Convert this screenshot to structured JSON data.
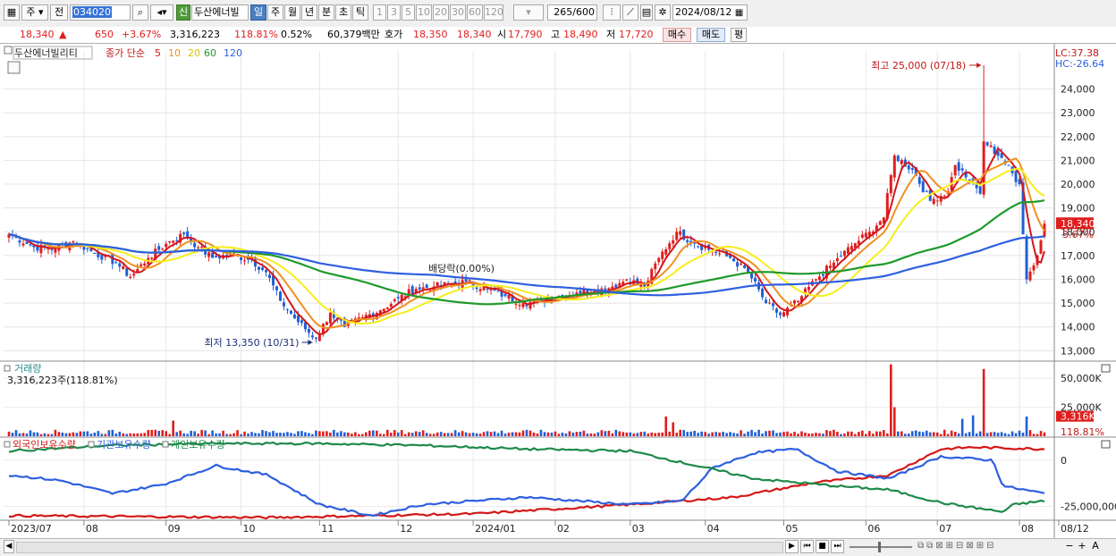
{
  "toolbar": {
    "type_label": "주",
    "prev_label": "전",
    "code": "034020",
    "name_badge": "신",
    "name": "두산에너빌",
    "periods": [
      "일",
      "주",
      "월",
      "년",
      "분",
      "초",
      "틱"
    ],
    "active_period": "일",
    "intervals": [
      "1",
      "3",
      "5",
      "10",
      "20",
      "30",
      "60",
      "120"
    ],
    "bars_shown": "265",
    "bars_total": "/600",
    "date": "2024/08/12"
  },
  "quote": {
    "price": "18,340",
    "arrow": "▲",
    "change": "650",
    "change_pct": "+3.67%",
    "volume": "3,316,223",
    "volume_ratio": "118.81%",
    "turnover": "0.52%",
    "amount": "60,379백만",
    "bid_label": "호가",
    "bid1": "18,350",
    "bid2": "18,340",
    "open_label": "시",
    "open": "17,790",
    "high_label": "고",
    "high": "18,490",
    "low_label": "저",
    "low": "17,720",
    "buy_label": "매수",
    "sell_label": "매도",
    "eval_label": "평"
  },
  "colors": {
    "up": "#e11d1d",
    "down": "#1f5fd6",
    "ma5": "#d4161b",
    "ma10": "#f0901f",
    "ma20": "#f5ee1a",
    "ma60": "#1e9a2b",
    "ma120": "#2e5fe0"
  },
  "chart_data": [
    {
      "type": "candlestick",
      "title": "두산에너빌리티",
      "ma_prefix": "종가 단순",
      "ma_labels": [
        "5",
        "10",
        "20",
        "60",
        "120"
      ],
      "ma_periods": [
        5,
        10,
        20,
        60,
        120
      ],
      "ylim": [
        12600,
        25600
      ],
      "yticks": [
        13000,
        14000,
        15000,
        16000,
        17000,
        18000,
        19000,
        20000,
        21000,
        22000,
        23000,
        24000
      ],
      "ytick_labels": [
        "13,000",
        "14,000",
        "15,000",
        "16,000",
        "17,000",
        "18,000",
        "19,000",
        "20,000",
        "21,000",
        "22,000",
        "23,000",
        "24,000"
      ],
      "lc_label": "LC:37.38",
      "hc_label": "HC:-26.64",
      "last_price_label": "18,340",
      "last_change_label": "3.67%",
      "high_annotation": "최고 25,000 (07/18)",
      "low_annotation": "최저 13,350 (10/31)",
      "event_annotation": "배당락(0.00%)",
      "close_anchors": [
        [
          "2023-07-03",
          17900
        ],
        [
          "2023-07-12",
          17350
        ],
        [
          "2023-07-20",
          17300
        ],
        [
          "2023-07-27",
          17600
        ],
        [
          "2023-08-04",
          17100
        ],
        [
          "2023-08-14",
          16700
        ],
        [
          "2023-08-18",
          16100
        ],
        [
          "2023-08-25",
          16900
        ],
        [
          "2023-09-04",
          17600
        ],
        [
          "2023-09-08",
          17900
        ],
        [
          "2023-09-14",
          17350
        ],
        [
          "2023-09-20",
          16900
        ],
        [
          "2023-09-27",
          17050
        ],
        [
          "2023-10-05",
          16800
        ],
        [
          "2023-10-11",
          16300
        ],
        [
          "2023-10-17",
          15100
        ],
        [
          "2023-10-24",
          14200
        ],
        [
          "2023-10-31",
          13500
        ],
        [
          "2023-11-06",
          14600
        ],
        [
          "2023-11-10",
          14000
        ],
        [
          "2023-11-17",
          14400
        ],
        [
          "2023-11-24",
          14700
        ],
        [
          "2023-12-01",
          15200
        ],
        [
          "2023-12-08",
          15600
        ],
        [
          "2023-12-15",
          15700
        ],
        [
          "2023-12-22",
          15800
        ],
        [
          "2023-12-28",
          15900
        ],
        [
          "2024-01-05",
          15600
        ],
        [
          "2024-01-12",
          15300
        ],
        [
          "2024-01-19",
          15000
        ],
        [
          "2024-01-26",
          15100
        ],
        [
          "2024-02-02",
          15300
        ],
        [
          "2024-02-09",
          15450
        ],
        [
          "2024-02-16",
          15500
        ],
        [
          "2024-02-23",
          15700
        ],
        [
          "2024-02-29",
          16000
        ],
        [
          "2024-03-07",
          15700
        ],
        [
          "2024-03-13",
          16900
        ],
        [
          "2024-03-20",
          18000
        ],
        [
          "2024-03-27",
          17500
        ],
        [
          "2024-04-03",
          17200
        ],
        [
          "2024-04-10",
          16900
        ],
        [
          "2024-04-17",
          16300
        ],
        [
          "2024-04-24",
          15000
        ],
        [
          "2024-04-30",
          14500
        ],
        [
          "2024-05-07",
          15100
        ],
        [
          "2024-05-14",
          16000
        ],
        [
          "2024-05-21",
          16700
        ],
        [
          "2024-05-28",
          17400
        ],
        [
          "2024-06-04",
          18000
        ],
        [
          "2024-06-10",
          18600
        ],
        [
          "2024-06-13",
          21200
        ],
        [
          "2024-06-20",
          20600
        ],
        [
          "2024-06-27",
          19300
        ],
        [
          "2024-07-04",
          19700
        ],
        [
          "2024-07-08",
          20800
        ],
        [
          "2024-07-12",
          20200
        ],
        [
          "2024-07-17",
          19600
        ],
        [
          "2024-07-18",
          21800
        ],
        [
          "2024-07-25",
          21100
        ],
        [
          "2024-08-01",
          20000
        ],
        [
          "2024-08-05",
          16000
        ],
        [
          "2024-08-08",
          17000
        ],
        [
          "2024-08-12",
          18340
        ]
      ]
    },
    {
      "type": "bar",
      "title": "거래량",
      "current_label": "3,316,223주(118.81%)",
      "ylim": [
        0,
        64000000
      ],
      "yticks": [
        25000000,
        50000000
      ],
      "ytick_labels": [
        "25,000K",
        "50,000K"
      ],
      "last_value_label": "3,316K",
      "last_pct_label": "118.81%",
      "baseline_volume": 3500000,
      "spikes": [
        [
          "2023-09-05",
          13500000
        ],
        [
          "2024-03-15",
          17000000
        ],
        [
          "2024-03-19",
          12000000
        ],
        [
          "2024-06-12",
          62000000
        ],
        [
          "2024-06-13",
          25000000
        ],
        [
          "2024-07-18",
          58000000
        ],
        [
          "2024-08-05",
          17000000
        ],
        [
          "2024-07-10",
          15000000
        ],
        [
          "2024-07-15",
          18000000
        ]
      ]
    },
    {
      "type": "line",
      "series_names": [
        "외국인보유수량",
        "기관보유수량",
        "개인보유수량"
      ],
      "ylim": [
        -32000000,
        12000000
      ],
      "yticks": [
        0,
        -25000000
      ],
      "ytick_labels": [
        "0",
        "-25,000,000"
      ],
      "x_labels": [
        "2023/07",
        "08",
        "09",
        "10",
        "11",
        "12",
        "2024/01",
        "02",
        "03",
        "04",
        "05",
        "06",
        "07",
        "08",
        "08/12"
      ]
    }
  ],
  "bottombar": {
    "nav_labels": [
      "▶",
      "⏮",
      "■",
      "⏭"
    ],
    "zoom_labels": [
      "−",
      "+",
      "A"
    ]
  }
}
